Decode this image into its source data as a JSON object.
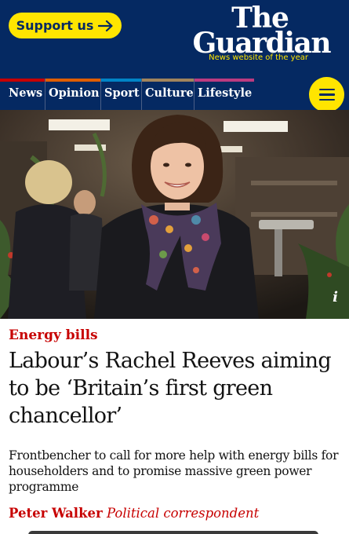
{
  "header": {
    "support_label": "Support us",
    "logo_line1": "The",
    "logo_line2": "Guardian",
    "tagline": "News website of the year"
  },
  "nav": {
    "items": [
      {
        "label": "News",
        "color": "#c70000"
      },
      {
        "label": "Opinion",
        "color": "#e05e00"
      },
      {
        "label": "Sport",
        "color": "#0084c6"
      },
      {
        "label": "Culture",
        "color": "#a1845c"
      },
      {
        "label": "Lifestyle",
        "color": "#bb3b80"
      }
    ],
    "menu_icon": "hamburger-icon"
  },
  "photo": {
    "info_label": "i"
  },
  "article": {
    "kicker": "Energy bills",
    "headline": "Labour’s Rachel Reeves aiming to be ‘Britain’s first green chancellor’",
    "standfirst": "Frontbencher to call for more help with energy bills for householders and to promise massive green power programme",
    "author": "Peter Walker",
    "role": "Political correspondent"
  },
  "colors": {
    "brand_blue": "#052962",
    "highlight_yellow": "#ffe500",
    "news_red": "#c70000"
  }
}
